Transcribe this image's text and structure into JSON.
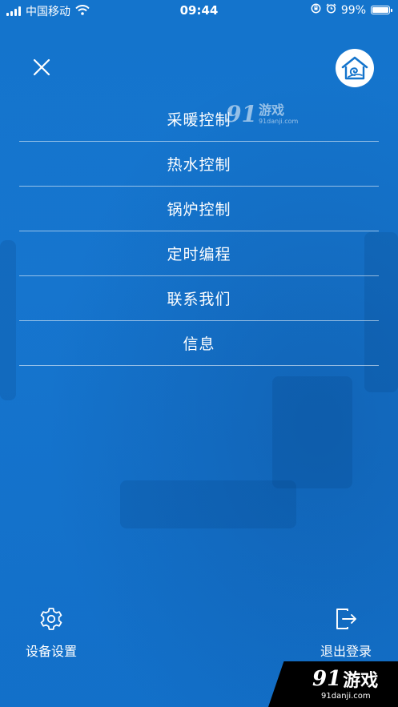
{
  "status_bar": {
    "carrier": "中国移动",
    "time": "09:44",
    "battery_percent": "99%",
    "battery_level": 0.99,
    "icons": [
      "signal-icon",
      "wifi-icon",
      "rotation-lock-icon",
      "alarm-icon",
      "battery-icon"
    ]
  },
  "header": {
    "close_icon": "close-icon",
    "logo_icon": "home-logo-icon"
  },
  "menu": {
    "items": [
      {
        "label": "采暖控制"
      },
      {
        "label": "热水控制"
      },
      {
        "label": "锅炉控制"
      },
      {
        "label": "定时编程"
      },
      {
        "label": "联系我们"
      },
      {
        "label": "信息"
      }
    ]
  },
  "footer": {
    "settings_label": "设备设置",
    "settings_icon": "gear-icon",
    "logout_label": "退出登录",
    "logout_icon": "logout-icon"
  },
  "watermark": {
    "number": "91",
    "brand": "游戏",
    "url": "91danji.com"
  },
  "colors": {
    "background": "#1474cc",
    "text": "#ffffff",
    "divider": "#8cbbe8"
  }
}
